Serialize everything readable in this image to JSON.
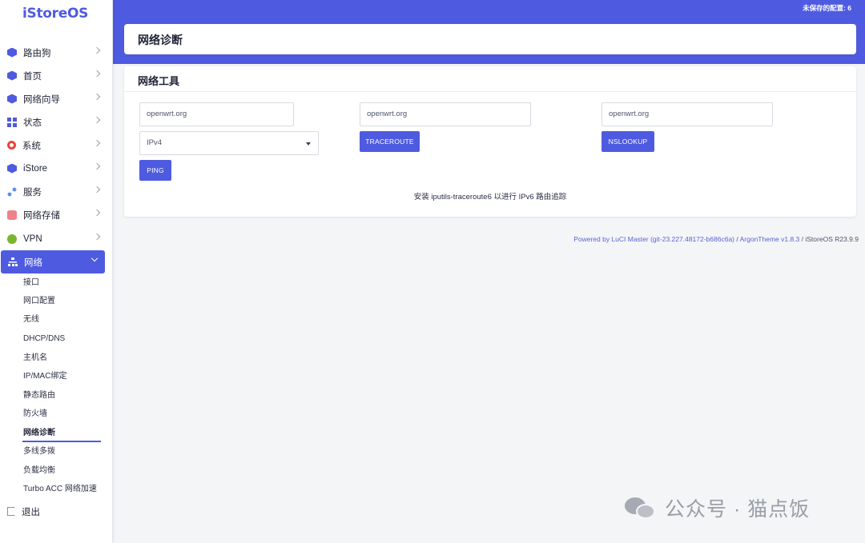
{
  "app": {
    "logo": "iStoreOS",
    "unsaved_changes": "未保存的配置: 6"
  },
  "sidebar": {
    "items": [
      {
        "label": "路由狗",
        "icon": "cube-icon"
      },
      {
        "label": "首页",
        "icon": "cube-icon"
      },
      {
        "label": "网络向导",
        "icon": "cube-icon"
      },
      {
        "label": "状态",
        "icon": "dashboard-grid-icon"
      },
      {
        "label": "系统",
        "icon": "gear-icon"
      },
      {
        "label": "iStore",
        "icon": "cube-icon"
      },
      {
        "label": "服务",
        "icon": "nodes-icon"
      },
      {
        "label": "网络存储",
        "icon": "database-icon"
      },
      {
        "label": "VPN",
        "icon": "vpn-icon"
      },
      {
        "label": "网络",
        "icon": "network-icon",
        "expanded": true
      }
    ],
    "submenu": [
      "接口",
      "网口配置",
      "无线",
      "DHCP/DNS",
      "主机名",
      "IP/MAC绑定",
      "静态路由",
      "防火墙",
      "网络诊断",
      "多线多拨",
      "负载均衡",
      "Turbo ACC 网络加速"
    ],
    "current_submenu": "网络诊断",
    "logout": "退出"
  },
  "page": {
    "title": "网络诊断",
    "section_title": "网络工具",
    "ping": {
      "host_value": "openwrt.org",
      "protocol_selected": "IPv4",
      "button": "PING"
    },
    "traceroute": {
      "host_value": "openwrt.org",
      "button": "TRACEROUTE"
    },
    "nslookup": {
      "host_value": "openwrt.org",
      "button": "NSLOOKUP"
    },
    "hint": "安装 iputils-traceroute6 以进行 IPv6 路由追踪"
  },
  "footer": {
    "powered": "Powered by LuCI Master (git-23.227.48172-b686c6a)",
    "separator1": " / ",
    "theme": "ArgonTheme v1.8.3",
    "separator2": " / ",
    "version": "iStoreOS R23.9.9"
  },
  "watermark": {
    "text": "公众号 · 猫点饭"
  },
  "colors": {
    "accent": "#4e5be0",
    "background": "#f4f5f7",
    "card": "#ffffff"
  }
}
